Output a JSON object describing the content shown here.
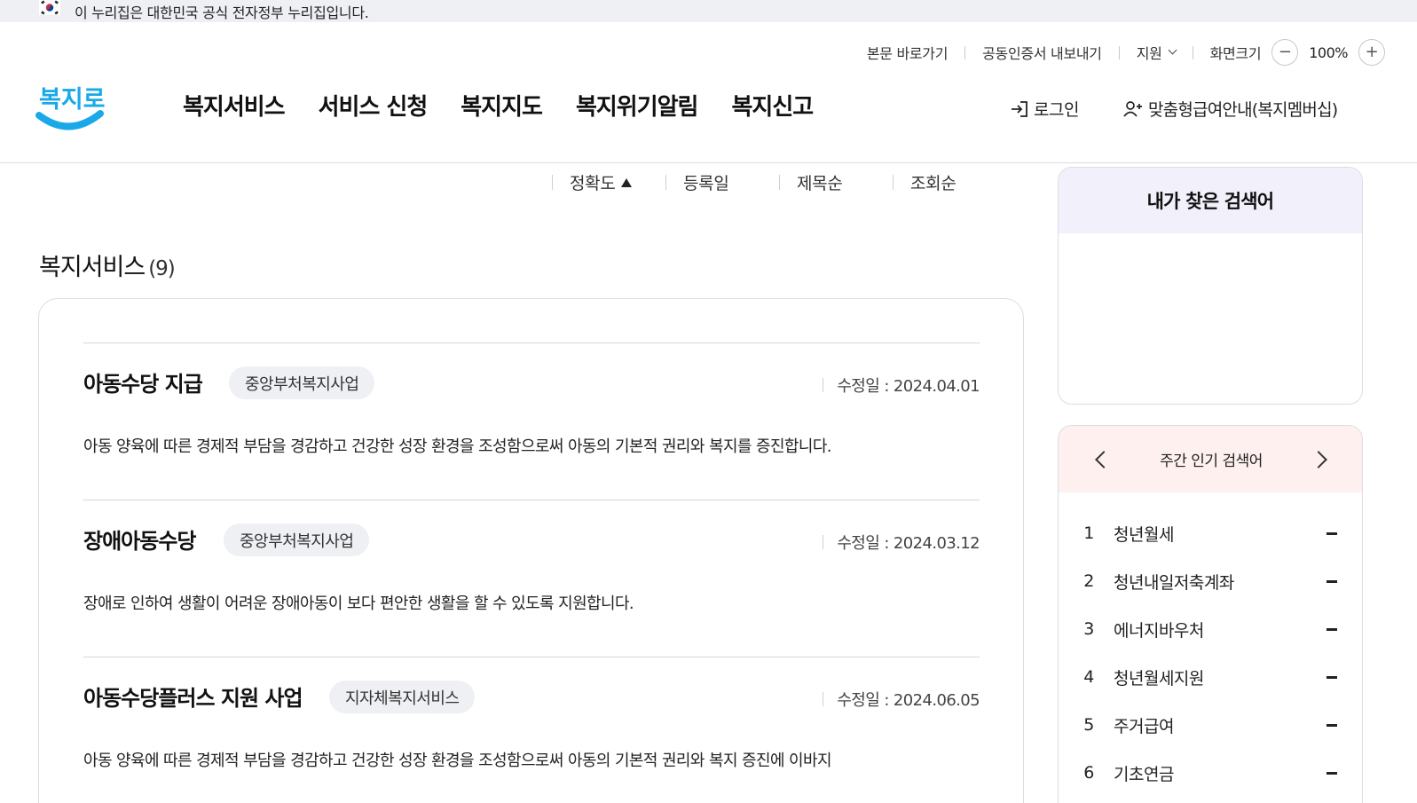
{
  "gov_banner": {
    "text": "이 누리집은 대한민국 공식 전자정부 누리집입니다."
  },
  "utility": {
    "skip_to_content": "본문 바로가기",
    "cert_export": "공동인증서 내보내기",
    "support": "지원",
    "screen_size": "화면크기",
    "zoom_out": "−",
    "zoom_level": "100%",
    "zoom_in": "+"
  },
  "logo": {
    "text": "복지로",
    "color": "#1aa9e8"
  },
  "nav": {
    "items": [
      "복지서비스",
      "서비스 신청",
      "복지지도",
      "복지위기알림",
      "복지신고"
    ],
    "login": "로그인",
    "membership": "맞춤형급여안내(복지멤버십)"
  },
  "sort": {
    "options": [
      "정확도",
      "등록일",
      "제목순",
      "조회순"
    ],
    "active": "정확도"
  },
  "section": {
    "title": "복지서비스",
    "count": "(9)"
  },
  "results": [
    {
      "title": "아동수당 지급",
      "badge": "중앙부처복지사업",
      "date_label": "수정일 : 2024.04.01",
      "description": "아동 양육에 따른 경제적 부담을 경감하고 건강한 성장 환경을 조성함으로써 아동의 기본적 권리와 복지를 증진합니다."
    },
    {
      "title": "장애아동수당",
      "badge": "중앙부처복지사업",
      "date_label": "수정일 : 2024.03.12",
      "description": "장애로 인하여 생활이 어려운 장애아동이 보다 편안한 생활을 할 수 있도록 지원합니다."
    },
    {
      "title": "아동수당플러스 지원 사업",
      "badge": "지자체복지서비스",
      "date_label": "수정일 : 2024.06.05",
      "description": "아동 양육에 따른 경제적 부담을 경감하고 건강한 성장 환경을 조성함으로써 아동의 기본적 권리와 복지 증진에 이바지"
    }
  ],
  "my_searches": {
    "title": "내가 찾은 검색어"
  },
  "popular": {
    "title": "주간 인기 검색어",
    "items": [
      {
        "rank": "1",
        "label": "청년월세",
        "change": "-"
      },
      {
        "rank": "2",
        "label": "청년내일저축계좌",
        "change": "-"
      },
      {
        "rank": "3",
        "label": "에너지바우처",
        "change": "-"
      },
      {
        "rank": "4",
        "label": "청년월세지원",
        "change": "-"
      },
      {
        "rank": "5",
        "label": "주거급여",
        "change": "-"
      },
      {
        "rank": "6",
        "label": "기초연금",
        "change": "-"
      }
    ]
  },
  "colors": {
    "gov_banner_bg": "#eef0f4",
    "badge_bg": "#eef0f4",
    "my_search_header_bg": "#f1f0fb",
    "popular_header_bg": "#fdf0ef",
    "logo_blue": "#1aa9e8"
  }
}
